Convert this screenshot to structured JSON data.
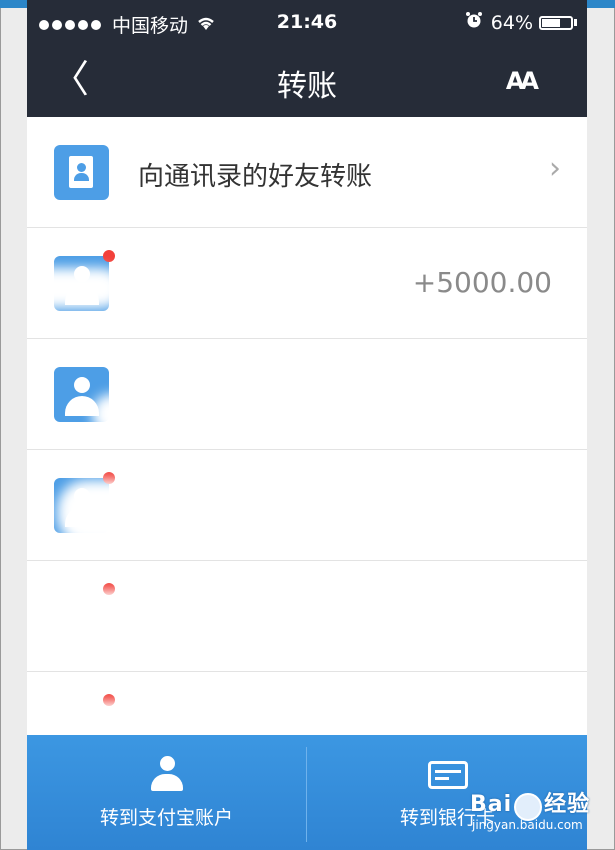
{
  "status": {
    "carrier": "中国移动",
    "time": "21:46",
    "battery": "64%",
    "battery_level": 0.64
  },
  "nav": {
    "back": "〈",
    "title": "转账",
    "font_button": "AA"
  },
  "list": {
    "contacts_row": "向通讯录的好友转账",
    "chevron": "›",
    "amount": "+5000.00"
  },
  "bottom": {
    "alipay_label": "转到支付宝账户",
    "bank_label": "转到银行卡"
  },
  "watermark": {
    "brand": "Bai",
    "brand2": "经验",
    "site": "jingyan.baidu.com"
  },
  "colors": {
    "nav_bg": "#262c38",
    "accent": "#3c97e2",
    "icon_blue": "#4d9ee6",
    "badge_red": "#f2403a"
  }
}
